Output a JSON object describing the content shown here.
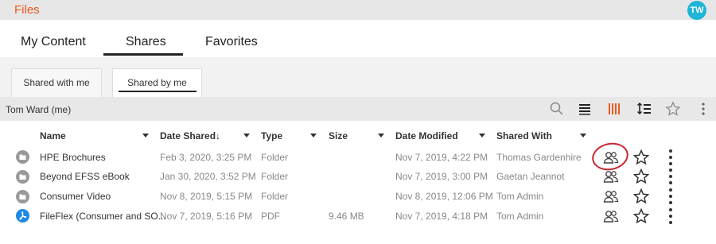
{
  "app": {
    "title": "Files",
    "avatar_initials": "TW"
  },
  "main_tabs": [
    {
      "label": "My Content"
    },
    {
      "label": "Shares",
      "active": true
    },
    {
      "label": "Favorites"
    }
  ],
  "sub_tabs": [
    {
      "label": "Shared with me"
    },
    {
      "label": "Shared by me",
      "active": true
    }
  ],
  "path": {
    "label": "Tom Ward (me)"
  },
  "toolbar": {
    "icons": [
      "search-icon",
      "list-view-icon",
      "column-view-icon",
      "sort-icon",
      "favorite-star-icon",
      "more-vertical-icon"
    ],
    "accent_color": "#e85a1f"
  },
  "columns": {
    "name": "Name",
    "date_shared": "Date Shared↓",
    "type": "Type",
    "size": "Size",
    "date_modified": "Date Modified",
    "shared_with": "Shared With"
  },
  "rows": [
    {
      "icon": "folder-icon",
      "name": "HPE Brochures",
      "date_shared": "Feb 3, 2020, 3:25 PM",
      "type": "Folder",
      "size": "",
      "date_modified": "Nov 7, 2019, 4:22 PM",
      "shared_with": "Thomas Gardenhire"
    },
    {
      "icon": "folder-icon",
      "name": "Beyond EFSS eBook",
      "date_shared": "Jan 30, 2020, 3:52 PM",
      "type": "Folder",
      "size": "",
      "date_modified": "Nov 7, 2019, 3:00 PM",
      "shared_with": "Gaetan Jeannot"
    },
    {
      "icon": "folder-icon",
      "name": "Consumer Video",
      "date_shared": "Nov 8, 2019, 5:15 PM",
      "type": "Folder",
      "size": "",
      "date_modified": "Nov 8, 2019, 12:06 PM",
      "shared_with": "Tom Admin"
    },
    {
      "icon": "pdf-icon",
      "name": "FileFlex (Consumer and SO...",
      "date_shared": "Nov 7, 2019, 5:16 PM",
      "type": "PDF",
      "size": "9.46 MB",
      "date_modified": "Nov 7, 2019, 4:18 PM",
      "shared_with": "Tom Admin"
    }
  ]
}
